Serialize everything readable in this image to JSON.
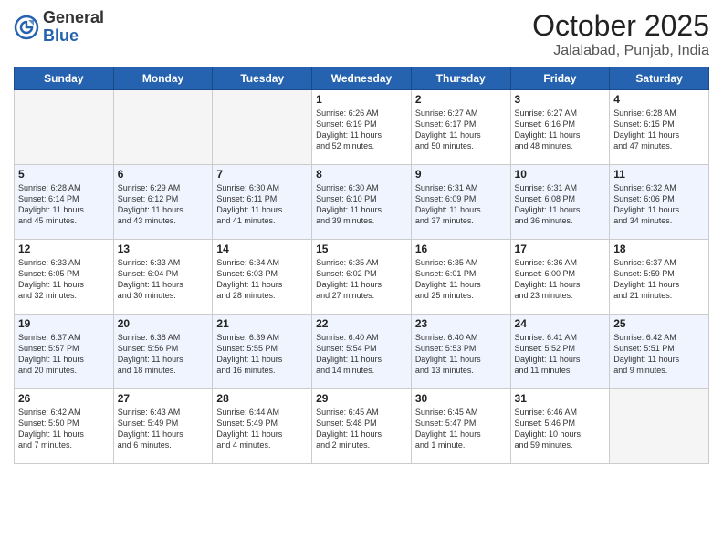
{
  "header": {
    "logo_general": "General",
    "logo_blue": "Blue",
    "month": "October 2025",
    "location": "Jalalabad, Punjab, India"
  },
  "days_of_week": [
    "Sunday",
    "Monday",
    "Tuesday",
    "Wednesday",
    "Thursday",
    "Friday",
    "Saturday"
  ],
  "weeks": [
    {
      "shaded": false,
      "days": [
        {
          "num": "",
          "empty": true,
          "content": ""
        },
        {
          "num": "",
          "empty": true,
          "content": ""
        },
        {
          "num": "",
          "empty": true,
          "content": ""
        },
        {
          "num": "1",
          "empty": false,
          "content": "Sunrise: 6:26 AM\nSunset: 6:19 PM\nDaylight: 11 hours\nand 52 minutes."
        },
        {
          "num": "2",
          "empty": false,
          "content": "Sunrise: 6:27 AM\nSunset: 6:17 PM\nDaylight: 11 hours\nand 50 minutes."
        },
        {
          "num": "3",
          "empty": false,
          "content": "Sunrise: 6:27 AM\nSunset: 6:16 PM\nDaylight: 11 hours\nand 48 minutes."
        },
        {
          "num": "4",
          "empty": false,
          "content": "Sunrise: 6:28 AM\nSunset: 6:15 PM\nDaylight: 11 hours\nand 47 minutes."
        }
      ]
    },
    {
      "shaded": true,
      "days": [
        {
          "num": "5",
          "empty": false,
          "content": "Sunrise: 6:28 AM\nSunset: 6:14 PM\nDaylight: 11 hours\nand 45 minutes."
        },
        {
          "num": "6",
          "empty": false,
          "content": "Sunrise: 6:29 AM\nSunset: 6:12 PM\nDaylight: 11 hours\nand 43 minutes."
        },
        {
          "num": "7",
          "empty": false,
          "content": "Sunrise: 6:30 AM\nSunset: 6:11 PM\nDaylight: 11 hours\nand 41 minutes."
        },
        {
          "num": "8",
          "empty": false,
          "content": "Sunrise: 6:30 AM\nSunset: 6:10 PM\nDaylight: 11 hours\nand 39 minutes."
        },
        {
          "num": "9",
          "empty": false,
          "content": "Sunrise: 6:31 AM\nSunset: 6:09 PM\nDaylight: 11 hours\nand 37 minutes."
        },
        {
          "num": "10",
          "empty": false,
          "content": "Sunrise: 6:31 AM\nSunset: 6:08 PM\nDaylight: 11 hours\nand 36 minutes."
        },
        {
          "num": "11",
          "empty": false,
          "content": "Sunrise: 6:32 AM\nSunset: 6:06 PM\nDaylight: 11 hours\nand 34 minutes."
        }
      ]
    },
    {
      "shaded": false,
      "days": [
        {
          "num": "12",
          "empty": false,
          "content": "Sunrise: 6:33 AM\nSunset: 6:05 PM\nDaylight: 11 hours\nand 32 minutes."
        },
        {
          "num": "13",
          "empty": false,
          "content": "Sunrise: 6:33 AM\nSunset: 6:04 PM\nDaylight: 11 hours\nand 30 minutes."
        },
        {
          "num": "14",
          "empty": false,
          "content": "Sunrise: 6:34 AM\nSunset: 6:03 PM\nDaylight: 11 hours\nand 28 minutes."
        },
        {
          "num": "15",
          "empty": false,
          "content": "Sunrise: 6:35 AM\nSunset: 6:02 PM\nDaylight: 11 hours\nand 27 minutes."
        },
        {
          "num": "16",
          "empty": false,
          "content": "Sunrise: 6:35 AM\nSunset: 6:01 PM\nDaylight: 11 hours\nand 25 minutes."
        },
        {
          "num": "17",
          "empty": false,
          "content": "Sunrise: 6:36 AM\nSunset: 6:00 PM\nDaylight: 11 hours\nand 23 minutes."
        },
        {
          "num": "18",
          "empty": false,
          "content": "Sunrise: 6:37 AM\nSunset: 5:59 PM\nDaylight: 11 hours\nand 21 minutes."
        }
      ]
    },
    {
      "shaded": true,
      "days": [
        {
          "num": "19",
          "empty": false,
          "content": "Sunrise: 6:37 AM\nSunset: 5:57 PM\nDaylight: 11 hours\nand 20 minutes."
        },
        {
          "num": "20",
          "empty": false,
          "content": "Sunrise: 6:38 AM\nSunset: 5:56 PM\nDaylight: 11 hours\nand 18 minutes."
        },
        {
          "num": "21",
          "empty": false,
          "content": "Sunrise: 6:39 AM\nSunset: 5:55 PM\nDaylight: 11 hours\nand 16 minutes."
        },
        {
          "num": "22",
          "empty": false,
          "content": "Sunrise: 6:40 AM\nSunset: 5:54 PM\nDaylight: 11 hours\nand 14 minutes."
        },
        {
          "num": "23",
          "empty": false,
          "content": "Sunrise: 6:40 AM\nSunset: 5:53 PM\nDaylight: 11 hours\nand 13 minutes."
        },
        {
          "num": "24",
          "empty": false,
          "content": "Sunrise: 6:41 AM\nSunset: 5:52 PM\nDaylight: 11 hours\nand 11 minutes."
        },
        {
          "num": "25",
          "empty": false,
          "content": "Sunrise: 6:42 AM\nSunset: 5:51 PM\nDaylight: 11 hours\nand 9 minutes."
        }
      ]
    },
    {
      "shaded": false,
      "days": [
        {
          "num": "26",
          "empty": false,
          "content": "Sunrise: 6:42 AM\nSunset: 5:50 PM\nDaylight: 11 hours\nand 7 minutes."
        },
        {
          "num": "27",
          "empty": false,
          "content": "Sunrise: 6:43 AM\nSunset: 5:49 PM\nDaylight: 11 hours\nand 6 minutes."
        },
        {
          "num": "28",
          "empty": false,
          "content": "Sunrise: 6:44 AM\nSunset: 5:49 PM\nDaylight: 11 hours\nand 4 minutes."
        },
        {
          "num": "29",
          "empty": false,
          "content": "Sunrise: 6:45 AM\nSunset: 5:48 PM\nDaylight: 11 hours\nand 2 minutes."
        },
        {
          "num": "30",
          "empty": false,
          "content": "Sunrise: 6:45 AM\nSunset: 5:47 PM\nDaylight: 11 hours\nand 1 minute."
        },
        {
          "num": "31",
          "empty": false,
          "content": "Sunrise: 6:46 AM\nSunset: 5:46 PM\nDaylight: 10 hours\nand 59 minutes."
        },
        {
          "num": "",
          "empty": true,
          "content": ""
        }
      ]
    }
  ]
}
